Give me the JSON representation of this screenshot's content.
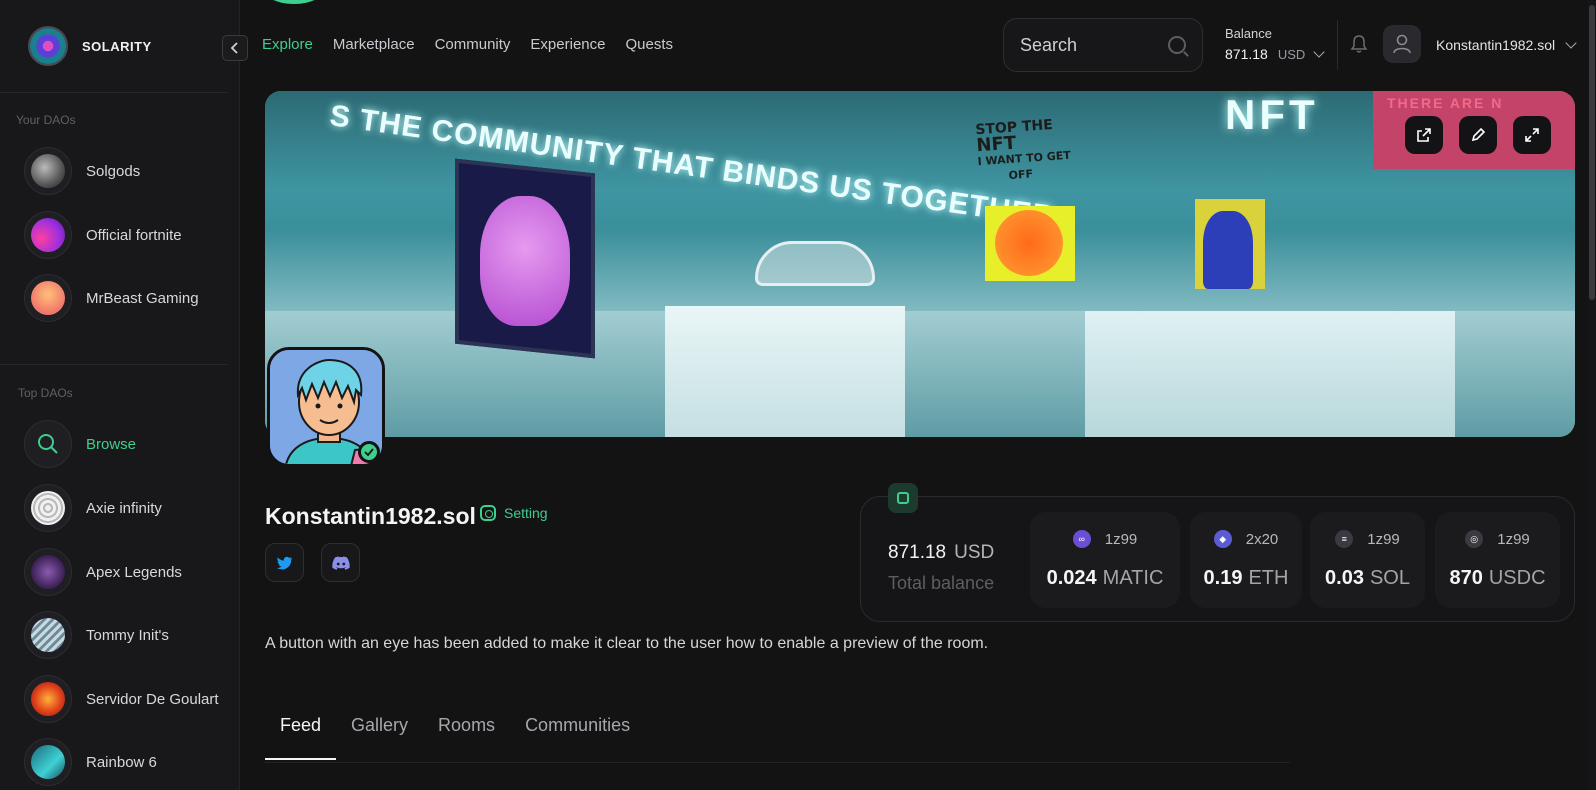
{
  "app": {
    "brand": "SOLARITY"
  },
  "sidebar": {
    "your_daos_title": "Your DAOs",
    "your_daos": [
      {
        "label": "Solgods",
        "color": "#8a8a8a"
      },
      {
        "label": "Official fortnite",
        "color": "#c43ad6"
      },
      {
        "label": "MrBeast Gaming",
        "color": "#f08a6a"
      }
    ],
    "top_daos_title": "Top DAOs",
    "browse_label": "Browse",
    "top_daos": [
      {
        "label": "Axie infinity",
        "color": "#dcdcdc"
      },
      {
        "label": "Apex Legends",
        "color": "#5a3a7a"
      },
      {
        "label": "Tommy Init's",
        "color": "#8fb3c4"
      },
      {
        "label": "Servidor De Goulart",
        "color": "#e04a1a"
      },
      {
        "label": "Rainbow 6",
        "color": "#2aa6b0"
      }
    ]
  },
  "nav": {
    "items": [
      "Explore",
      "Marketplace",
      "Community",
      "Experience",
      "Quests"
    ],
    "active": "Explore"
  },
  "search": {
    "placeholder": "Search"
  },
  "balance": {
    "label": "Balance",
    "amount": "871.18",
    "currency": "USD"
  },
  "user": {
    "name": "Konstantin1982.sol"
  },
  "banner": {
    "ceiling_text": "S THE COMMUNITY THAT BINDS US TOGETHER",
    "sign_text": "THERE ARE N",
    "neon_text": "NFT",
    "doodle_lines": [
      "STOP THE",
      "NFT",
      "I WANT TO GET",
      "OFF"
    ]
  },
  "profile": {
    "name": "Konstantin1982.sol",
    "setting_label": "Setting",
    "description": "A button with an eye has been added to make it clear to the user how to enable a preview of the room."
  },
  "wallet": {
    "total_amount": "871.18",
    "total_currency": "USD",
    "total_label": "Total balance",
    "coins": [
      {
        "id": "1z99",
        "value": "0.024",
        "unit": "MATIC",
        "color": "#6a4fd6"
      },
      {
        "id": "2x20",
        "value": "0.19",
        "unit": "ETH",
        "color": "#5b5bd6"
      },
      {
        "id": "1z99",
        "value": "0.03",
        "unit": "SOL",
        "color": "#3a3a40"
      },
      {
        "id": "1z99",
        "value": "870",
        "unit": "USDC",
        "color": "#3a3a40"
      }
    ]
  },
  "tabs": {
    "items": [
      "Feed",
      "Gallery",
      "Rooms",
      "Communities"
    ],
    "active": "Feed"
  },
  "colors": {
    "accent": "#3ecf8e",
    "background": "#131314",
    "sidebar": "#18181a"
  }
}
